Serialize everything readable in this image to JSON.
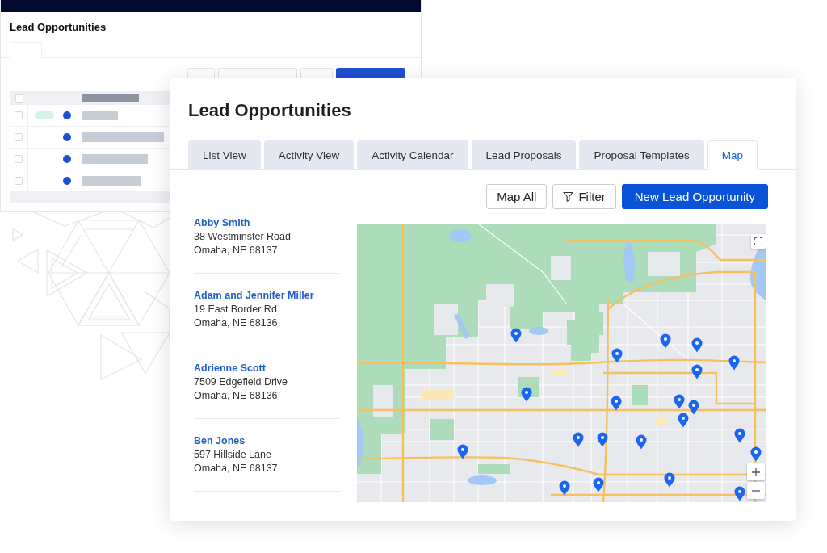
{
  "back_window": {
    "title": "Lead Opportunities",
    "tab": {
      "selected": true
    },
    "buttons": [
      {
        "kind": "outline"
      },
      {
        "kind": "outline"
      },
      {
        "kind": "outline"
      },
      {
        "kind": "primary"
      }
    ],
    "table": {
      "header": {
        "checked": false
      },
      "rows": [
        {
          "checked": false,
          "tagged": true
        },
        {
          "checked": false,
          "tagged": false
        },
        {
          "checked": false,
          "tagged": false
        },
        {
          "checked": false,
          "tagged": false
        }
      ]
    }
  },
  "window": {
    "title": "Lead Opportunities"
  },
  "tabs": [
    {
      "label": "List View",
      "selected": false
    },
    {
      "label": "Activity View",
      "selected": false
    },
    {
      "label": "Activity Calendar",
      "selected": false
    },
    {
      "label": "Lead Proposals",
      "selected": false
    },
    {
      "label": "Proposal Templates",
      "selected": false
    },
    {
      "label": "Map",
      "selected": true
    }
  ],
  "toolbar": [
    {
      "label": "Map All",
      "kind": "outline"
    },
    {
      "label": "Filter",
      "kind": "filter"
    },
    {
      "label": "New Lead Opportunity",
      "kind": "primary"
    }
  ],
  "leads": [
    {
      "name": "Abby Smith",
      "street": "38 Westminster Road",
      "city": "Omaha, NE 68137"
    },
    {
      "name": "Adam and Jennifer Miller",
      "street": "19 East Border Rd",
      "city": "Omaha, NE 68136"
    },
    {
      "name": "Adrienne Scott",
      "street": "7509 Edgefield Drive",
      "city": "Omaha, NE 68136"
    },
    {
      "name": "Ben Jones",
      "street": "597 Hillside Lane",
      "city": "Omaha, NE 68137"
    }
  ]
}
